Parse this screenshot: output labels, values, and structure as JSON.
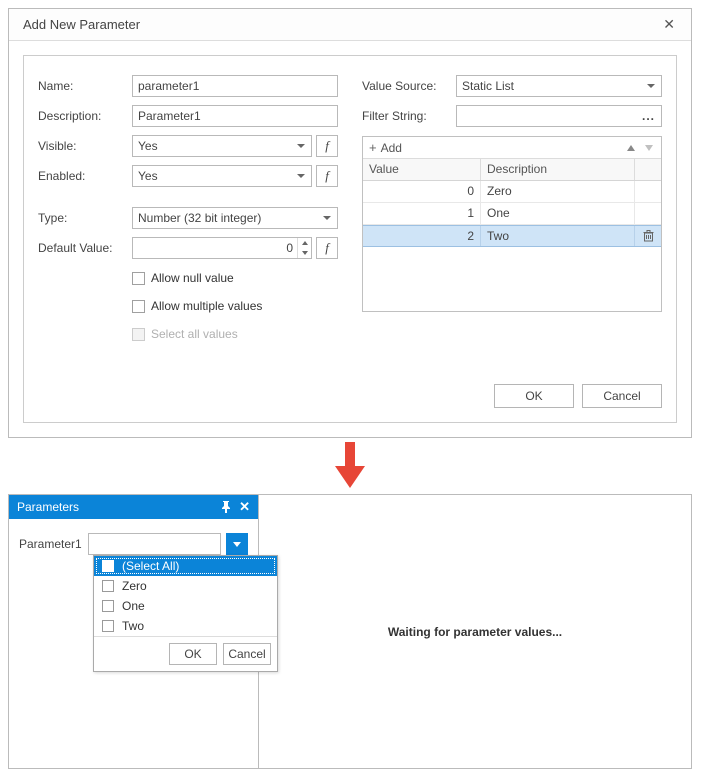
{
  "dialog": {
    "title": "Add New Parameter",
    "labels": {
      "name": "Name:",
      "description": "Description:",
      "visible": "Visible:",
      "enabled": "Enabled:",
      "type": "Type:",
      "default_value": "Default Value:",
      "value_source": "Value Source:",
      "filter_string": "Filter String:"
    },
    "values": {
      "name": "parameter1",
      "description": "Parameter1",
      "visible": "Yes",
      "enabled": "Yes",
      "type": "Number (32 bit integer)",
      "default_value": "0",
      "value_source": "Static List",
      "filter_string": ""
    },
    "checkboxes": {
      "allow_null": "Allow null value",
      "allow_multiple": "Allow multiple values",
      "select_all": "Select all values"
    },
    "list": {
      "add_label": "Add",
      "columns": {
        "value": "Value",
        "description": "Description"
      },
      "rows": [
        {
          "value": "0",
          "description": "Zero"
        },
        {
          "value": "1",
          "description": "One"
        },
        {
          "value": "2",
          "description": "Two",
          "selected": true
        }
      ]
    },
    "buttons": {
      "ok": "OK",
      "cancel": "Cancel"
    },
    "fx_label": "f"
  },
  "panel": {
    "title": "Parameters",
    "param_label": "Parameter1",
    "dropdown": {
      "select_all": "(Select All)",
      "options": [
        "Zero",
        "One",
        "Two"
      ],
      "ok": "OK",
      "cancel": "Cancel"
    },
    "waiting": "Waiting for parameter values..."
  }
}
